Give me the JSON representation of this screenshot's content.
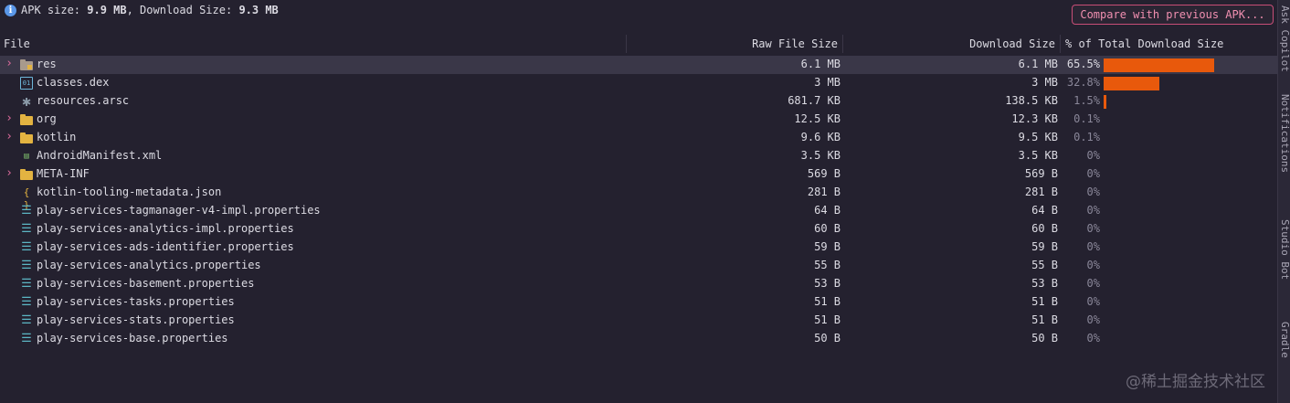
{
  "summary": {
    "apk_size_label": "APK size: ",
    "apk_size_value": "9.9 MB",
    "download_size_label": ", Download Size: ",
    "download_size_value": "9.3 MB"
  },
  "toolbar": {
    "compare_label": "Compare with previous APK..."
  },
  "columns": {
    "file": "File",
    "raw": "Raw File Size",
    "download": "Download Size",
    "percent": "% of Total Download Size"
  },
  "rows": [
    {
      "name": "res",
      "raw": "6.1 MB",
      "download": "6.1 MB",
      "percent": "65.5%",
      "share": 65.5,
      "icon": "folder-res-icon",
      "expandable": true
    },
    {
      "name": "classes.dex",
      "raw": "3 MB",
      "download": "3 MB",
      "percent": "32.8%",
      "share": 32.8,
      "icon": "dex-file-icon",
      "expandable": false
    },
    {
      "name": "resources.arsc",
      "raw": "681.7 KB",
      "download": "138.5 KB",
      "percent": "1.5%",
      "share": 1.5,
      "icon": "arsc-file-icon",
      "expandable": false
    },
    {
      "name": "org",
      "raw": "12.5 KB",
      "download": "12.3 KB",
      "percent": "0.1%",
      "share": 0.1,
      "icon": "folder-icon",
      "expandable": true
    },
    {
      "name": "kotlin",
      "raw": "9.6 KB",
      "download": "9.5 KB",
      "percent": "0.1%",
      "share": 0.1,
      "icon": "folder-icon",
      "expandable": true
    },
    {
      "name": "AndroidManifest.xml",
      "raw": "3.5 KB",
      "download": "3.5 KB",
      "percent": "0%",
      "share": 0,
      "icon": "manifest-file-icon",
      "expandable": false
    },
    {
      "name": "META-INF",
      "raw": "569 B",
      "download": "569 B",
      "percent": "0%",
      "share": 0,
      "icon": "folder-icon",
      "expandable": true
    },
    {
      "name": "kotlin-tooling-metadata.json",
      "raw": "281 B",
      "download": "281 B",
      "percent": "0%",
      "share": 0,
      "icon": "json-file-icon",
      "expandable": false
    },
    {
      "name": "play-services-tagmanager-v4-impl.properties",
      "raw": "64 B",
      "download": "64 B",
      "percent": "0%",
      "share": 0,
      "icon": "properties-file-icon",
      "expandable": false
    },
    {
      "name": "play-services-analytics-impl.properties",
      "raw": "60 B",
      "download": "60 B",
      "percent": "0%",
      "share": 0,
      "icon": "properties-file-icon",
      "expandable": false
    },
    {
      "name": "play-services-ads-identifier.properties",
      "raw": "59 B",
      "download": "59 B",
      "percent": "0%",
      "share": 0,
      "icon": "properties-file-icon",
      "expandable": false
    },
    {
      "name": "play-services-analytics.properties",
      "raw": "55 B",
      "download": "55 B",
      "percent": "0%",
      "share": 0,
      "icon": "properties-file-icon",
      "expandable": false
    },
    {
      "name": "play-services-basement.properties",
      "raw": "53 B",
      "download": "53 B",
      "percent": "0%",
      "share": 0,
      "icon": "properties-file-icon",
      "expandable": false
    },
    {
      "name": "play-services-tasks.properties",
      "raw": "51 B",
      "download": "51 B",
      "percent": "0%",
      "share": 0,
      "icon": "properties-file-icon",
      "expandable": false
    },
    {
      "name": "play-services-stats.properties",
      "raw": "51 B",
      "download": "51 B",
      "percent": "0%",
      "share": 0,
      "icon": "properties-file-icon",
      "expandable": false
    },
    {
      "name": "play-services-base.properties",
      "raw": "50 B",
      "download": "50 B",
      "percent": "0%",
      "share": 0,
      "icon": "properties-file-icon",
      "expandable": false
    }
  ],
  "side_tabs": [
    "Ask Copilot",
    "Notifications",
    "Studio Bot",
    "Gradle"
  ],
  "watermark": "@稀土掘金技术社区",
  "colors": {
    "accent": "#e8590c",
    "background": "#24212f",
    "selection": "#3a3748",
    "button_border": "#c84e77"
  }
}
